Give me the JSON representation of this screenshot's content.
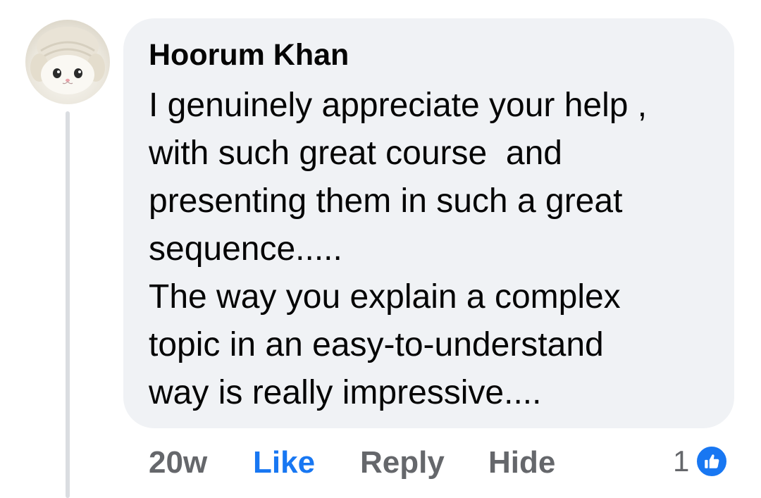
{
  "comment": {
    "author_name": "Hoorum Khan",
    "lines": [
      "I genuinely appreciate your help ,",
      "with such great course  and",
      "presenting them in such a great",
      "sequence.....",
      "The way you explain a complex",
      "topic in an easy-to-understand",
      "way is really impressive...."
    ],
    "avatar_icon": "kitten-avatar-icon"
  },
  "actions": {
    "timestamp": "20w",
    "like_label": "Like",
    "reply_label": "Reply",
    "hide_label": "Hide"
  },
  "reactions": {
    "count": "1",
    "icon": "like-reaction-icon"
  },
  "colors": {
    "bubble": "#f0f2f5",
    "like_active": "#1877f2",
    "muted_text": "#65676b",
    "body_text": "#050505"
  }
}
